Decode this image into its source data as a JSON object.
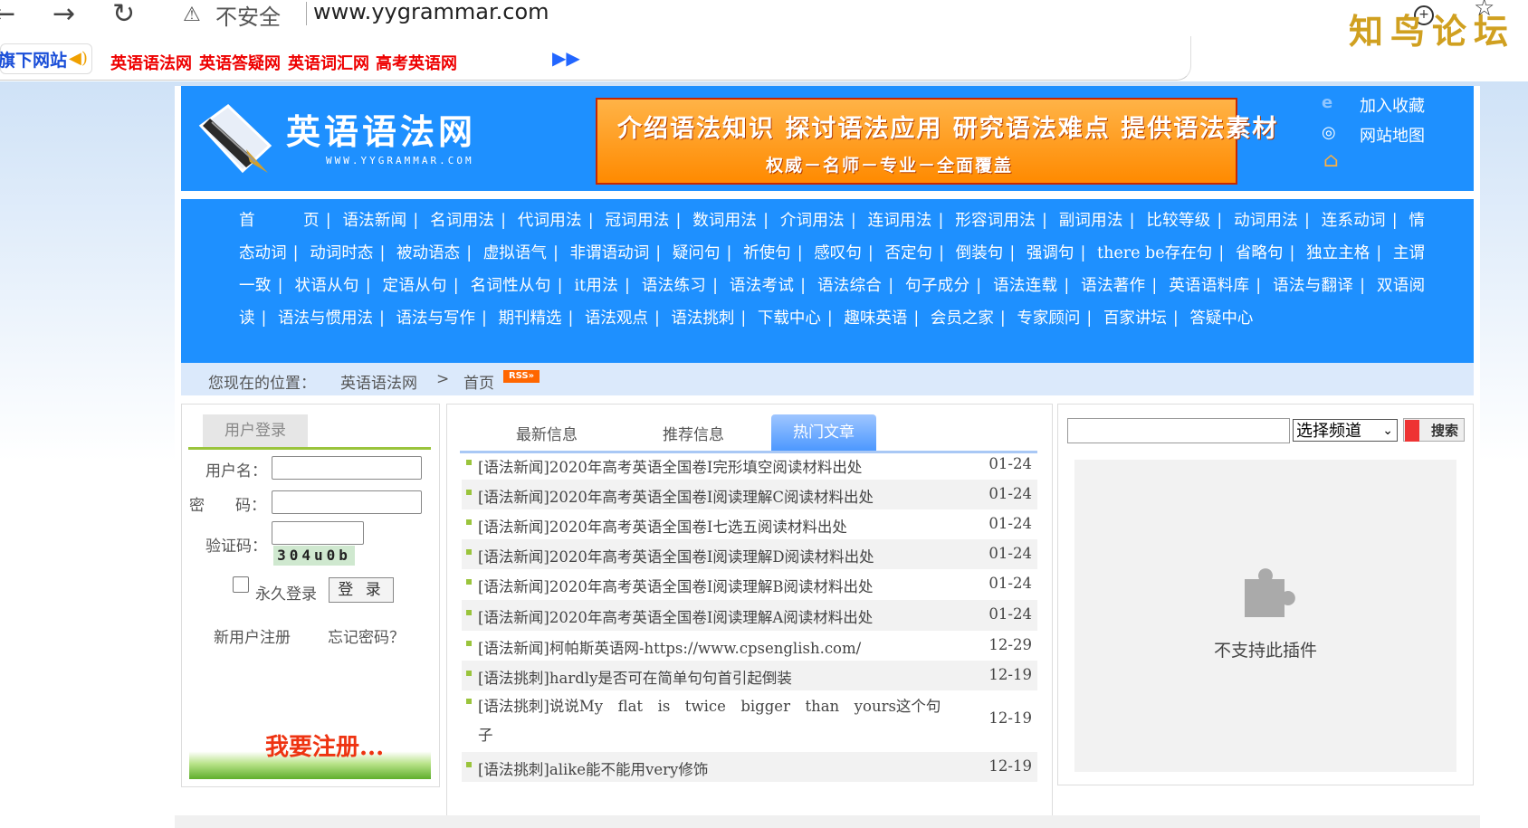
{
  "browser": {
    "back_icon": "←",
    "forward_icon": "→",
    "reload_icon": "↻",
    "warning_icon": "⚠",
    "security_label": "不安全",
    "url": "www.yygrammar.com",
    "watermark": "知鸟论坛",
    "star_icon": "☆",
    "plus_icon": "+"
  },
  "toplinks": {
    "download_label": "旗下网站",
    "speaker_icon": "◀)",
    "links": [
      "英语语法网",
      "英语答疑网",
      "英语词汇网",
      "高考英语网"
    ],
    "more_icon": "▶▶"
  },
  "header": {
    "title": "英语语法网",
    "url_text": "WWW.YYGRAMMAR.COM",
    "banner_line1": "介绍语法知识  探讨语法应用  研究语法难点  提供语法素材",
    "banner_line2": "权威－名师－专业－全面覆盖",
    "bookmark_label": "加入收藏",
    "sitemap_label": "网站地图",
    "home_icon": "⌂",
    "ie_icon": "e",
    "map_icon": "◎"
  },
  "nav": {
    "items": [
      "首　　　页",
      "语法新闻",
      "名词用法",
      "代词用法",
      "冠词用法",
      "数词用法",
      "介词用法",
      "连词用法",
      "形容词用法",
      "副词用法",
      "比较等级",
      "动词用法",
      "连系动词",
      "情态动词",
      "动词时态",
      "被动语态",
      "虚拟语气",
      "非谓语动词",
      "疑问句",
      "祈使句",
      "感叹句",
      "否定句",
      "倒装句",
      "强调句",
      "there be存在句",
      "省略句",
      "独立主格",
      "主谓一致",
      "状语从句",
      "定语从句",
      "名词性从句",
      "it用法",
      "语法练习",
      "语法考试",
      "语法综合",
      "句子成分",
      "语法连载",
      "语法著作",
      "英语语料库",
      "语法与翻译",
      "双语阅读",
      "语法与惯用法",
      "语法与写作",
      "期刊精选",
      "语法观点",
      "语法挑刺",
      "下载中心",
      "趣味英语",
      "会员之家",
      "专家顾问",
      "百家讲坛",
      "答疑中心"
    ]
  },
  "breadcrumb": {
    "label": "您现在的位置：",
    "site": "英语语法网",
    "sep": ">",
    "page": "首页",
    "rss": "RSS»"
  },
  "login": {
    "tab": "用户登录",
    "username_label": "用户名：",
    "password_label": "密　　码：",
    "captcha_label": "验证码：",
    "captcha_text": "304u0b",
    "remember_label": "永久登录",
    "login_button": "登 录",
    "register_link": "新用户注册",
    "forgot_link": "忘记密码？",
    "register_banner": "我要注册..."
  },
  "articles": {
    "tabs": [
      "最新信息",
      "推荐信息",
      "热门文章"
    ],
    "active_tab": "热门文章",
    "rows": [
      {
        "title": "[语法新闻]2020年高考英语全国卷Ⅰ完形填空阅读材料出处",
        "date": "01-24"
      },
      {
        "title": "[语法新闻]2020年高考英语全国卷Ⅰ阅读理解C阅读材料出处",
        "date": "01-24"
      },
      {
        "title": "[语法新闻]2020年高考英语全国卷Ⅰ七选五阅读材料出处",
        "date": "01-24"
      },
      {
        "title": "[语法新闻]2020年高考英语全国卷Ⅰ阅读理解D阅读材料出处",
        "date": "01-24"
      },
      {
        "title": "[语法新闻]2020年高考英语全国卷Ⅰ阅读理解B阅读材料出处",
        "date": "01-24"
      },
      {
        "title": "[语法新闻]2020年高考英语全国卷Ⅰ阅读理解A阅读材料出处",
        "date": "01-24"
      },
      {
        "title": "[语法新闻]柯帕斯英语网-https://www.cpsenglish.com/",
        "date": "12-29"
      },
      {
        "title": "[语法挑刺]hardly是否可在简单句句首引起倒装",
        "date": "12-19"
      },
      {
        "title": "[语法挑刺]说说My　flat　is　twice　bigger　than　yours这个句",
        "title2": "子",
        "date": "12-19"
      },
      {
        "title": "[语法挑刺]alike能不能用very修饰",
        "date": "12-19"
      }
    ]
  },
  "search": {
    "select_value": "选择频道",
    "button": "搜索",
    "plugin_text": "不支持此插件",
    "plugin_icon": "puzzle-piece"
  }
}
